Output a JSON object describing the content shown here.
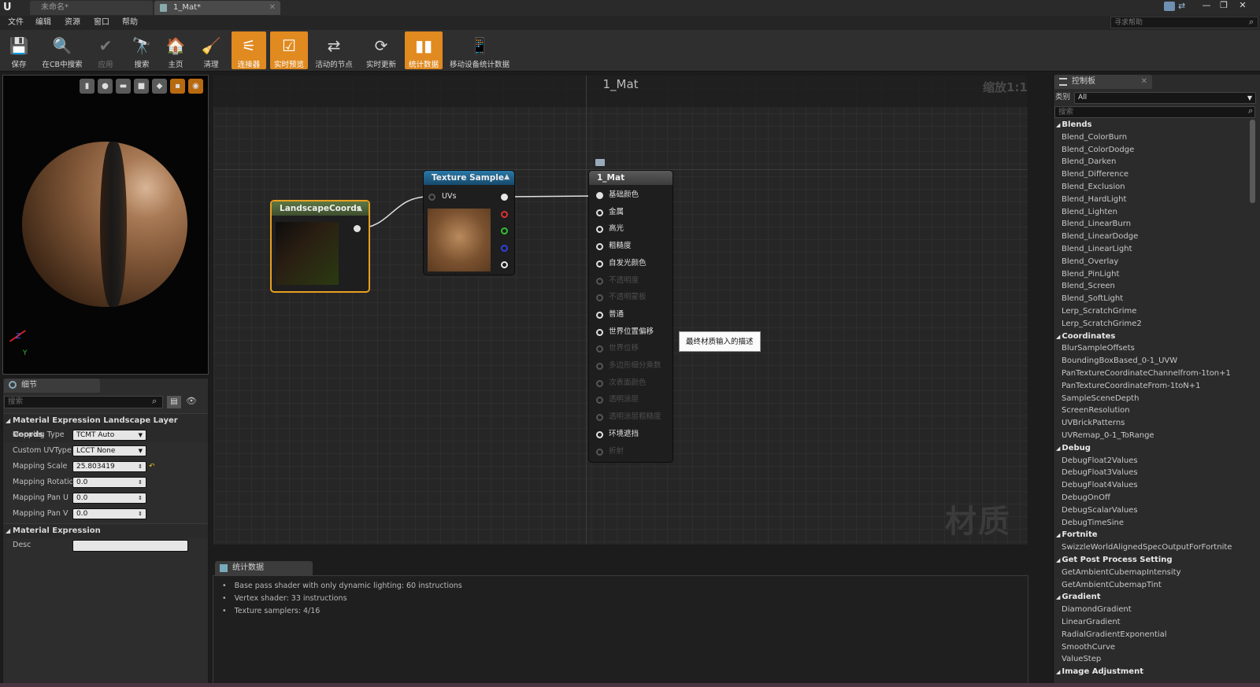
{
  "titlebar": {
    "logo": "U",
    "tabs": [
      {
        "label": "未命名*",
        "active": false
      },
      {
        "label": "1_Mat*",
        "active": true
      }
    ],
    "window_buttons": [
      "—",
      "❐",
      "✕"
    ]
  },
  "menubar": {
    "items": [
      "文件",
      "编辑",
      "资源",
      "窗口",
      "帮助"
    ],
    "help_search_placeholder": "寻求帮助"
  },
  "toolbar": {
    "buttons": [
      {
        "label": "保存",
        "icon": "save-icon",
        "glyph": "💾",
        "state": "normal"
      },
      {
        "label": "在CB中搜索",
        "icon": "search-icon",
        "glyph": "🔍",
        "state": "normal"
      },
      {
        "label": "应用",
        "icon": "check-icon",
        "glyph": "✔",
        "state": "dim"
      },
      {
        "label": "搜索",
        "icon": "binoculars-icon",
        "glyph": "🔭",
        "state": "normal"
      },
      {
        "label": "主页",
        "icon": "home-icon",
        "glyph": "🏠",
        "state": "normal"
      },
      {
        "label": "清理",
        "icon": "broom-icon",
        "glyph": "🧹",
        "state": "normal"
      },
      {
        "label": "连接器",
        "icon": "connector-icon",
        "glyph": "⚟",
        "state": "on"
      },
      {
        "label": "实时预览",
        "icon": "live-preview-icon",
        "glyph": "☑",
        "state": "on"
      },
      {
        "label": "活动的节点",
        "icon": "live-nodes-icon",
        "glyph": "⇄",
        "state": "normal"
      },
      {
        "label": "实时更新",
        "icon": "refresh-icon",
        "glyph": "⟳",
        "state": "normal"
      },
      {
        "label": "统计数据",
        "icon": "stats-icon",
        "glyph": "▮▮",
        "state": "on"
      },
      {
        "label": "移动设备统计数据",
        "icon": "mobile-stats-icon",
        "glyph": "📱",
        "state": "normal"
      }
    ]
  },
  "viewport": {
    "buttons": [
      "cylinder",
      "sphere",
      "plane",
      "cube",
      "mesh",
      "background",
      "realtime"
    ],
    "axis_z": "Z",
    "axis_y": "Y"
  },
  "details": {
    "tab_label": "细节",
    "search_placeholder": "搜索",
    "category1": "Material Expression Landscape Layer Coords",
    "props": [
      {
        "label": "Mapping Type",
        "value": "TCMT Auto",
        "kind": "combo"
      },
      {
        "label": "Custom UVType",
        "value": "LCCT None",
        "kind": "combo"
      },
      {
        "label": "Mapping Scale",
        "value": "25.803419",
        "kind": "num"
      },
      {
        "label": "Mapping Rotation",
        "value": "0.0",
        "kind": "num"
      },
      {
        "label": "Mapping Pan U",
        "value": "0.0",
        "kind": "num"
      },
      {
        "label": "Mapping Pan V",
        "value": "0.0",
        "kind": "num"
      }
    ],
    "category2": "Material Expression",
    "desc_label": "Desc",
    "desc_value": ""
  },
  "graph": {
    "title": "1_Mat",
    "zoom": "缩放1:1",
    "watermark": "材质",
    "landscape_node": {
      "title": "LandscapeCoords"
    },
    "texture_node": {
      "title": "Texture Sample",
      "input": "UVs",
      "output_colors": [
        "#e8e8e8",
        "#e03030",
        "#30c030",
        "#3040e0",
        "#e8e8e8"
      ]
    },
    "material_node": {
      "title": "1_Mat",
      "pins": [
        {
          "label": "基础颜色",
          "enabled": true,
          "connected": true
        },
        {
          "label": "金属",
          "enabled": true,
          "connected": false
        },
        {
          "label": "高光",
          "enabled": true,
          "connected": false
        },
        {
          "label": "粗糙度",
          "enabled": true,
          "connected": false
        },
        {
          "label": "自发光颜色",
          "enabled": true,
          "connected": false
        },
        {
          "label": "不透明度",
          "enabled": false,
          "connected": false
        },
        {
          "label": "不透明蒙板",
          "enabled": false,
          "connected": false
        },
        {
          "label": "普通",
          "enabled": true,
          "connected": false
        },
        {
          "label": "世界位置偏移",
          "enabled": true,
          "connected": false
        },
        {
          "label": "世界位移",
          "enabled": false,
          "connected": false
        },
        {
          "label": "多边形细分乘数",
          "enabled": false,
          "connected": false
        },
        {
          "label": "次表面颜色",
          "enabled": false,
          "connected": false
        },
        {
          "label": "透明涂层",
          "enabled": false,
          "connected": false
        },
        {
          "label": "透明涂层粗糙度",
          "enabled": false,
          "connected": false
        },
        {
          "label": "环境遮挡",
          "enabled": true,
          "connected": false
        },
        {
          "label": "折射",
          "enabled": false,
          "connected": false
        }
      ]
    },
    "tooltip": "最终材质输入的描述"
  },
  "stats": {
    "tab_label": "统计数据",
    "lines": [
      "Base pass shader with only dynamic lighting: 60 instructions",
      "Vertex shader: 33 instructions",
      "Texture samplers: 4/16"
    ]
  },
  "palette": {
    "tab_label": "控制板",
    "category_label": "类别",
    "category_value": "All",
    "search_placeholder": "搜索",
    "groups": [
      {
        "name": "Blends",
        "items": [
          "Blend_ColorBurn",
          "Blend_ColorDodge",
          "Blend_Darken",
          "Blend_Difference",
          "Blend_Exclusion",
          "Blend_HardLight",
          "Blend_Lighten",
          "Blend_LinearBurn",
          "Blend_LinearDodge",
          "Blend_LinearLight",
          "Blend_Overlay",
          "Blend_PinLight",
          "Blend_Screen",
          "Blend_SoftLight",
          "Lerp_ScratchGrime",
          "Lerp_ScratchGrime2"
        ]
      },
      {
        "name": "Coordinates",
        "items": [
          "BlurSampleOffsets",
          "BoundingBoxBased_0-1_UVW",
          "PanTextureCoordinateChannelfrom-1ton+1",
          "PanTextureCoordinateFrom-1toN+1",
          "SampleSceneDepth",
          "ScreenResolution",
          "UVBrickPatterns",
          "UVRemap_0-1_ToRange"
        ]
      },
      {
        "name": "Debug",
        "items": [
          "DebugFloat2Values",
          "DebugFloat3Values",
          "DebugFloat4Values",
          "DebugOnOff",
          "DebugScalarValues",
          "DebugTimeSine"
        ]
      },
      {
        "name": "Fortnite",
        "items": [
          "SwizzleWorldAlignedSpecOutputForFortnite"
        ]
      },
      {
        "name": "Get Post Process Setting",
        "items": [
          "GetAmbientCubemapIntensity",
          "GetAmbientCubemapTint"
        ]
      },
      {
        "name": "Gradient",
        "items": [
          "DiamondGradient",
          "LinearGradient",
          "RadialGradientExponential",
          "SmoothCurve",
          "ValueStep"
        ]
      },
      {
        "name": "Image Adjustment",
        "items": []
      }
    ]
  },
  "colors": {
    "accent": "#e08a20",
    "texture_header": "#1f5f88",
    "landscape_header": "#556a3a",
    "material_header": "#4e4e4e"
  }
}
